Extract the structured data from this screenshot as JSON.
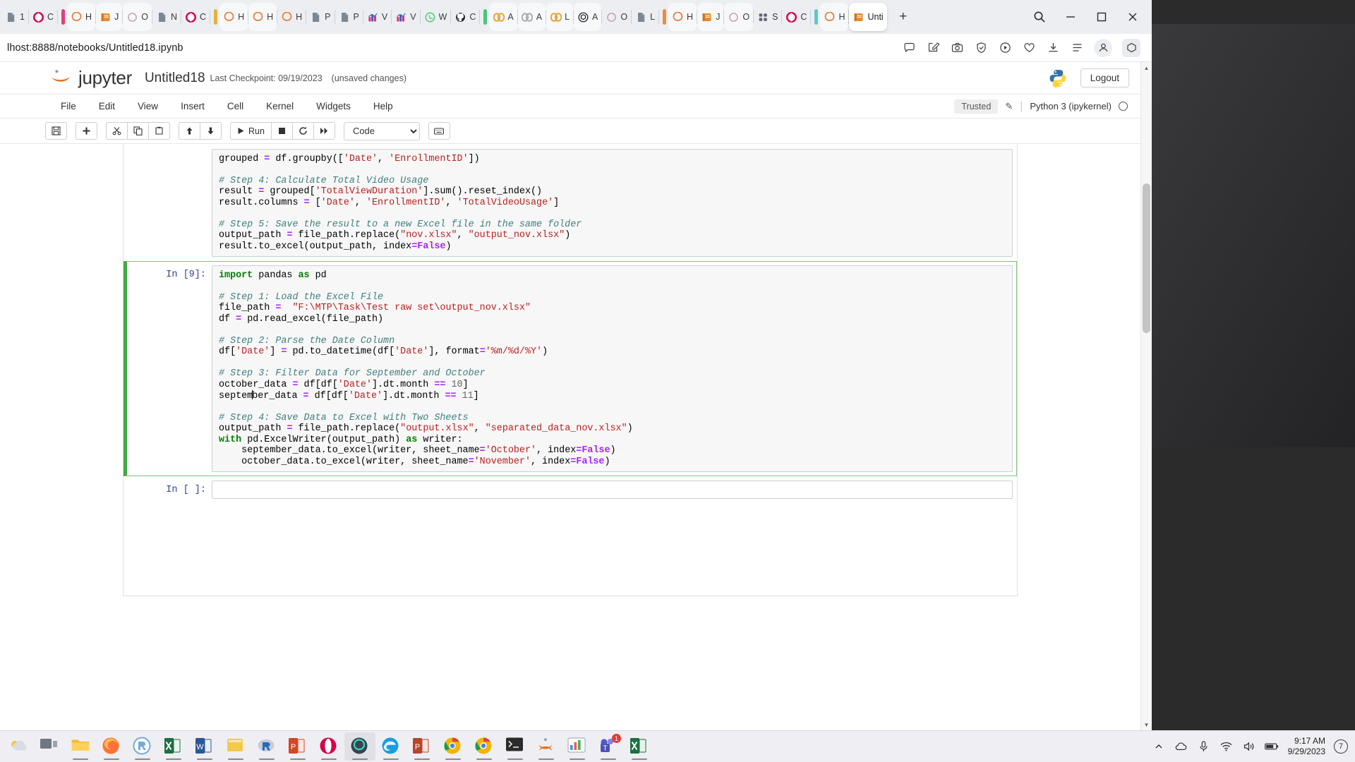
{
  "browser": {
    "tabs": [
      {
        "icon": "doc-icon",
        "label": "1",
        "group": null
      },
      {
        "icon": "opera-icon",
        "label": "C",
        "group": null
      },
      {
        "icon": "opera-gx-icon",
        "label": "H",
        "group": "pink",
        "active_group": true
      },
      {
        "icon": "jupyter-icon",
        "label": "J",
        "group": "pink"
      },
      {
        "icon": "opera-circle-icon",
        "label": "O",
        "group": "pink"
      },
      {
        "icon": "doc-icon",
        "label": "N",
        "group": null
      },
      {
        "icon": "opera-icon",
        "label": "C",
        "group": null
      },
      {
        "icon": "opera-gx-icon",
        "label": "H",
        "group": "yellow"
      },
      {
        "icon": "opera-gx-icon",
        "label": "H",
        "group": "yellow"
      },
      {
        "icon": "opera-gx-icon",
        "label": "H",
        "group": null
      },
      {
        "icon": "doc-icon",
        "label": "P",
        "group": null
      },
      {
        "icon": "doc-icon",
        "label": "P",
        "group": null
      },
      {
        "icon": "chart-icon",
        "label": "V",
        "group": null
      },
      {
        "icon": "chart-icon",
        "label": "V",
        "group": null
      },
      {
        "icon": "whatsapp-icon",
        "label": "W",
        "group": null
      },
      {
        "icon": "github-icon",
        "label": "C",
        "group": null
      },
      {
        "icon": "coursera-icon",
        "label": "A",
        "group": "green"
      },
      {
        "icon": "coursera-gray-icon",
        "label": "A",
        "group": "green"
      },
      {
        "icon": "coursera-icon",
        "label": "L",
        "group": "green"
      },
      {
        "icon": "openai-icon",
        "label": "A",
        "group": "green"
      },
      {
        "icon": "opera-circle-icon",
        "label": "O",
        "group": null
      },
      {
        "icon": "doc-icon",
        "label": "L",
        "group": null
      },
      {
        "icon": "opera-gx-icon",
        "label": "H",
        "group": "orange"
      },
      {
        "icon": "jupyter-icon",
        "label": "J",
        "group": "orange"
      },
      {
        "icon": "opera-circle-icon",
        "label": "O",
        "group": "orange"
      },
      {
        "icon": "grid-icon",
        "label": "S",
        "group": null
      },
      {
        "icon": "opera-icon",
        "label": "C",
        "group": null
      },
      {
        "icon": "opera-gx-icon",
        "label": "H",
        "group": "teal"
      },
      {
        "icon": "jupyter-icon",
        "label": "Unti",
        "group": "teal",
        "active": true
      }
    ],
    "new_tab_label": "+",
    "window_controls": [
      "minimize",
      "maximize",
      "close"
    ],
    "search_icon": "search-icon",
    "address": {
      "value": "lhost:8888/notebooks/Untitled18.ipynb",
      "icons": [
        "comment-icon",
        "edit-page-icon",
        "snapshot-icon",
        "shield-icon",
        "player-icon",
        "heart-icon",
        "download-icon",
        "list-icon",
        "profile-icon",
        "workspace-icon"
      ]
    }
  },
  "jupyter": {
    "logo_text": "jupyter",
    "notebook_title": "Untitled18",
    "last_checkpoint": "Last Checkpoint: 09/19/2023",
    "dirty_state": "(unsaved changes)",
    "logout_label": "Logout",
    "menu": [
      "File",
      "Edit",
      "View",
      "Insert",
      "Cell",
      "Kernel",
      "Widgets",
      "Help"
    ],
    "trusted_label": "Trusted",
    "kernel_label": "Python 3 (ipykernel)",
    "toolbar": {
      "save": "save-icon",
      "insert": "plus-icon",
      "cut": "scissors-icon",
      "copy": "copy-icon",
      "paste": "paste-icon",
      "move_up": "arrow-up-icon",
      "move_down": "arrow-down-icon",
      "run_label": "Run",
      "interrupt": "stop-icon",
      "restart": "restart-icon",
      "restart_run_all": "fast-forward-icon",
      "cell_type": "Code",
      "command_palette": "keyboard-icon"
    },
    "cells": [
      {
        "prompt": "",
        "selected": false,
        "partial_top": true,
        "lines": [
          [
            {
              "t": "grouped ",
              "c": "fn"
            },
            {
              "t": "=",
              "c": "o"
            },
            {
              "t": " df.groupby([",
              "c": "fn"
            },
            {
              "t": "'Date'",
              "c": "s"
            },
            {
              "t": ", ",
              "c": "fn"
            },
            {
              "t": "'EnrollmentID'",
              "c": "s"
            },
            {
              "t": "])",
              "c": "fn"
            }
          ],
          [],
          [
            {
              "t": "# Step 4: Calculate Total Video Usage",
              "c": "c"
            }
          ],
          [
            {
              "t": "result ",
              "c": "fn"
            },
            {
              "t": "=",
              "c": "o"
            },
            {
              "t": " grouped[",
              "c": "fn"
            },
            {
              "t": "'TotalViewDuration'",
              "c": "s"
            },
            {
              "t": "].sum().reset_index()",
              "c": "fn"
            }
          ],
          [
            {
              "t": "result.columns ",
              "c": "fn"
            },
            {
              "t": "=",
              "c": "o"
            },
            {
              "t": " [",
              "c": "fn"
            },
            {
              "t": "'Date'",
              "c": "s"
            },
            {
              "t": ", ",
              "c": "fn"
            },
            {
              "t": "'EnrollmentID'",
              "c": "s"
            },
            {
              "t": ", ",
              "c": "fn"
            },
            {
              "t": "'TotalVideoUsage'",
              "c": "s"
            },
            {
              "t": "]",
              "c": "fn"
            }
          ],
          [],
          [
            {
              "t": "# Step 5: Save the result to a new Excel file in the same folder",
              "c": "c"
            }
          ],
          [
            {
              "t": "output_path ",
              "c": "fn"
            },
            {
              "t": "=",
              "c": "o"
            },
            {
              "t": " file_path.replace(",
              "c": "fn"
            },
            {
              "t": "\"nov.xlsx\"",
              "c": "s"
            },
            {
              "t": ", ",
              "c": "fn"
            },
            {
              "t": "\"output_nov.xlsx\"",
              "c": "s"
            },
            {
              "t": ")",
              "c": "fn"
            }
          ],
          [
            {
              "t": "result.to_excel(output_path, index",
              "c": "fn"
            },
            {
              "t": "=",
              "c": "o"
            },
            {
              "t": "False",
              "c": "kw"
            },
            {
              "t": ")",
              "c": "fn"
            }
          ]
        ]
      },
      {
        "prompt": "In [9]:",
        "selected": true,
        "lines": [
          [
            {
              "t": "import",
              "c": "k"
            },
            {
              "t": " pandas ",
              "c": "fn"
            },
            {
              "t": "as",
              "c": "k"
            },
            {
              "t": " pd",
              "c": "fn"
            }
          ],
          [],
          [
            {
              "t": "# Step 1: Load the Excel File",
              "c": "c"
            }
          ],
          [
            {
              "t": "file_path ",
              "c": "fn"
            },
            {
              "t": "=",
              "c": "o"
            },
            {
              "t": "  ",
              "c": "fn"
            },
            {
              "t": "\"F:\\MTP\\Task\\Test raw set\\output_nov.xlsx\"",
              "c": "s"
            }
          ],
          [
            {
              "t": "df ",
              "c": "fn"
            },
            {
              "t": "=",
              "c": "o"
            },
            {
              "t": " pd.read_excel(file_path)",
              "c": "fn"
            }
          ],
          [],
          [
            {
              "t": "# Step 2: Parse the Date Column",
              "c": "c"
            }
          ],
          [
            {
              "t": "df[",
              "c": "fn"
            },
            {
              "t": "'Date'",
              "c": "s"
            },
            {
              "t": "] ",
              "c": "fn"
            },
            {
              "t": "=",
              "c": "o"
            },
            {
              "t": " pd.to_datetime(df[",
              "c": "fn"
            },
            {
              "t": "'Date'",
              "c": "s"
            },
            {
              "t": "], format",
              "c": "fn"
            },
            {
              "t": "=",
              "c": "o"
            },
            {
              "t": "'%m/%d/%Y'",
              "c": "s"
            },
            {
              "t": ")",
              "c": "fn"
            }
          ],
          [],
          [
            {
              "t": "# Step 3: Filter Data for September and October",
              "c": "c"
            }
          ],
          [
            {
              "t": "october_data ",
              "c": "fn"
            },
            {
              "t": "=",
              "c": "o"
            },
            {
              "t": " df[df[",
              "c": "fn"
            },
            {
              "t": "'Date'",
              "c": "s"
            },
            {
              "t": "].dt.month ",
              "c": "fn"
            },
            {
              "t": "==",
              "c": "o"
            },
            {
              "t": " ",
              "c": "fn"
            },
            {
              "t": "10",
              "c": "n"
            },
            {
              "t": "]",
              "c": "fn"
            }
          ],
          [
            {
              "t": "september_data ",
              "c": "fn",
              "caret_after": 6
            },
            {
              "t": "=",
              "c": "o"
            },
            {
              "t": " df[df[",
              "c": "fn"
            },
            {
              "t": "'Date'",
              "c": "s"
            },
            {
              "t": "].dt.month ",
              "c": "fn"
            },
            {
              "t": "==",
              "c": "o"
            },
            {
              "t": " ",
              "c": "fn"
            },
            {
              "t": "11",
              "c": "n"
            },
            {
              "t": "]",
              "c": "fn"
            }
          ],
          [],
          [
            {
              "t": "# Step 4: Save Data to Excel with Two Sheets",
              "c": "c"
            }
          ],
          [
            {
              "t": "output_path ",
              "c": "fn"
            },
            {
              "t": "=",
              "c": "o"
            },
            {
              "t": " file_path.replace(",
              "c": "fn"
            },
            {
              "t": "\"output.xlsx\"",
              "c": "s"
            },
            {
              "t": ", ",
              "c": "fn"
            },
            {
              "t": "\"separated_data_nov.xlsx\"",
              "c": "s"
            },
            {
              "t": ")",
              "c": "fn"
            }
          ],
          [
            {
              "t": "with",
              "c": "k"
            },
            {
              "t": " pd.ExcelWriter(output_path) ",
              "c": "fn"
            },
            {
              "t": "as",
              "c": "k"
            },
            {
              "t": " writer:",
              "c": "fn"
            }
          ],
          [
            {
              "t": "    september_data.to_excel(writer, sheet_name",
              "c": "fn"
            },
            {
              "t": "=",
              "c": "o"
            },
            {
              "t": "'October'",
              "c": "s"
            },
            {
              "t": ", index",
              "c": "fn"
            },
            {
              "t": "=",
              "c": "o"
            },
            {
              "t": "False",
              "c": "kw"
            },
            {
              "t": ")",
              "c": "fn"
            }
          ],
          [
            {
              "t": "    october_data.to_excel(writer, sheet_name",
              "c": "fn"
            },
            {
              "t": "=",
              "c": "o"
            },
            {
              "t": "'November'",
              "c": "s"
            },
            {
              "t": ", index",
              "c": "fn"
            },
            {
              "t": "=",
              "c": "o"
            },
            {
              "t": "False",
              "c": "kw"
            },
            {
              "t": ")",
              "c": "fn"
            }
          ]
        ]
      },
      {
        "prompt": "In [ ]:",
        "selected": false,
        "empty": true,
        "lines": [
          []
        ]
      }
    ]
  },
  "taskbar": {
    "items": [
      {
        "name": "weather-widget",
        "label": ""
      },
      {
        "name": "task-view",
        "label": ""
      },
      {
        "name": "file-explorer",
        "label": ""
      },
      {
        "name": "firefox",
        "label": ""
      },
      {
        "name": "rstudio",
        "label": ""
      },
      {
        "name": "excel",
        "label": ""
      },
      {
        "name": "word",
        "label": ""
      },
      {
        "name": "sticky-notes",
        "label": ""
      },
      {
        "name": "r-console",
        "label": ""
      },
      {
        "name": "powerpoint",
        "label": ""
      },
      {
        "name": "opera",
        "label": ""
      },
      {
        "name": "opera-gx",
        "label": ""
      },
      {
        "name": "edge",
        "label": ""
      },
      {
        "name": "powerpoint-2",
        "label": ""
      },
      {
        "name": "chrome",
        "label": ""
      },
      {
        "name": "chrome-2",
        "label": ""
      },
      {
        "name": "terminal",
        "label": ""
      },
      {
        "name": "jupyter-app",
        "label": ""
      },
      {
        "name": "charts-app",
        "label": ""
      },
      {
        "name": "teams",
        "label": "1"
      },
      {
        "name": "excel-2",
        "label": ""
      }
    ],
    "tray": {
      "show_hidden": "chevron-up-icon",
      "cloud": "cloud-icon",
      "mic": "mic-icon",
      "wifi": "wifi-icon",
      "volume": "volume-icon",
      "battery": "battery-icon",
      "time": "9:17 AM",
      "date": "9/29/2023",
      "notifications": "7"
    }
  }
}
